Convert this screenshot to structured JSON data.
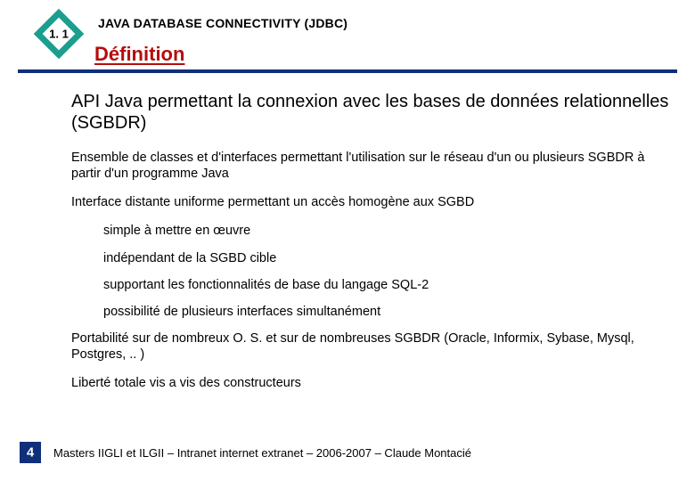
{
  "header": {
    "section_number": "1. 1",
    "chapter_title": "JAVA DATABASE CONNECTIVITY (JDBC)",
    "section_title": "Définition"
  },
  "content": {
    "lead": "API Java permettant la connexion avec les bases de données relationnelles (SGBDR)",
    "p1": "Ensemble de classes et d'interfaces permettant l'utilisation sur le réseau d'un ou plusieurs SGBDR à partir d'un programme Java",
    "p2": "Interface distante uniforme permettant un accès homogène aux SGBD",
    "sub": {
      "s1": "simple à mettre en œuvre",
      "s2": "indépendant de la SGBD cible",
      "s3": "supportant les fonctionnalités de base du langage SQL-2",
      "s4": "possibilité de plusieurs interfaces simultanément"
    },
    "p3": "Portabilité sur de nombreux O. S. et sur de nombreuses SGBDR (Oracle, Informix, Sybase, Mysql, Postgres, .. )",
    "p4": "Liberté totale vis a vis des constructeurs"
  },
  "footer": {
    "page": "4",
    "text": "Masters IIGLI et ILGII – Intranet internet extranet – 2006-2007 – Claude Montacié"
  }
}
